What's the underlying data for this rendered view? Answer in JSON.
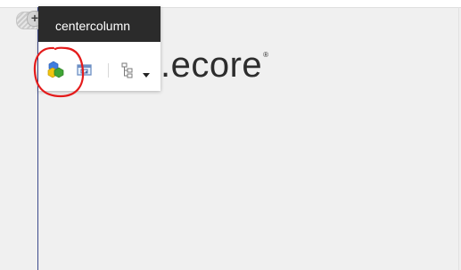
{
  "chrome": {
    "title": "centercolumn",
    "toolbar": [
      {
        "icon": "components-icon"
      },
      {
        "icon": "edit-field-icon"
      },
      {
        "icon": "tree-structure-icon"
      },
      {
        "icon": "dropdown-arrow-icon"
      }
    ]
  },
  "logo": {
    "text": ".ecore",
    "reg": "®"
  },
  "colors": {
    "header_bg": "#2b2b2b",
    "column_border": "#3c4a8c",
    "annotation": "#e41b1b"
  }
}
